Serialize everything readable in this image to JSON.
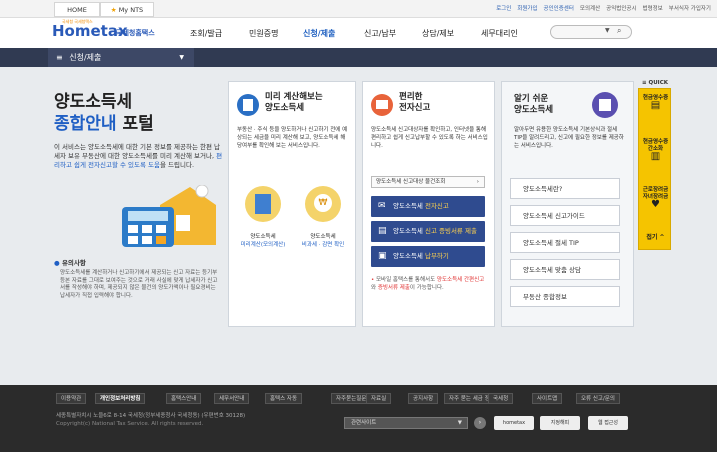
{
  "topbar": {
    "home": "HOME",
    "my_nts": "My NTS",
    "links": [
      "로그인",
      "회원가입",
      "공인인증센터",
      "모의계산",
      "공익법인공시",
      "법령정보",
      "부서식자 가입자기"
    ]
  },
  "header": {
    "logo": "Hometax",
    "logo_sub": "국세청홈택스",
    "logo_tag": "국세청 국세청택스",
    "nav": [
      "조회/발급",
      "민원증명",
      "신청/제출",
      "신고/납부",
      "상담/제보",
      "세무대리인"
    ],
    "active_nav": "신청/제출"
  },
  "subnav": {
    "label": "신청/제출"
  },
  "intro": {
    "title_line1": "양도소득세",
    "title_line2a": "종합안내",
    "title_line2b": " 포털",
    "desc_a": "이 서비스는 양도소득세에 대한 기본 정보를 제공하는 한편 납세자 보유 부동산에 대한 양도소득세를 미리 계산해 보거나, ",
    "desc_b": "편리하고 쉽게 전자신고할 수 있도록 도움",
    "desc_c": "을 드립니다.",
    "notice_title": "유의사항",
    "notice_text": "양도소득세를 계산하거나 신고하기에서 제공되는 신고 자료는 등기부등본 자료를 그대로 보여주는 것으로 거래 사실에 맞게 납세자가 신고서를 작성해야 하며, 제공되지 않은 물건의 양도가액이나 필요경비는 납세자가 직접 입력해야 합니다."
  },
  "calc": {
    "title1": "미리 계산해보는",
    "title2": "양도소득세",
    "desc": "부동산 · 주식 등을 양도하거나 신고하기 전에 예상되는 세금을 미리 계산해 보고, 양도소득세 해당여부를 확인해 보는 서비스입니다.",
    "btn1_title": "양도소득세",
    "btn1_sub": "미리계산(모의계산)",
    "btn2_title": "양도소득세",
    "btn2_sub": "비과세 · 감면 확인"
  },
  "efile": {
    "title1": "편리한",
    "title2": "전자신고",
    "desc": "양도소득세 신고대상자를 확인하고, 인터넷을 통해 편리하고 쉽게 신고납부할 수 있도록 하는 서비스입니다.",
    "lookup": "양도소득세 신고대상 물건조회",
    "b1a": "양도소득세 ",
    "b1b": "전자신고",
    "b2a": "양도소득세 ",
    "b2b": "신고 증빙서류 제출",
    "b3a": "양도소득세 ",
    "b3b": "납부하기",
    "note_a": "모바일 홈택스를 통해서도 ",
    "note_b": "양도소득세 간편신고",
    "note_c": "와 ",
    "note_d": "증빙서류 제출",
    "note_e": "이 가능합니다."
  },
  "guide": {
    "title1": "알기 쉬운",
    "title2": "양도소득세",
    "desc": "알아두면 유용한 양도소득세 기본상식과 절세 TIP을 알려드리고, 신고에 필요한 정보를 제공하는 서비스입니다.",
    "items": [
      "양도소득세란?",
      "양도소득세 신고가이드",
      "양도소득세 절세 TIP",
      "양도소득세 맞춤 상담",
      "부동산 종합정보"
    ]
  },
  "quick": {
    "label": "QUICK",
    "items": [
      "현금영수증",
      "현금영수증간소화",
      "근로장려금자녀장려금"
    ],
    "close": "접기"
  },
  "footer": {
    "links": [
      "이용약관",
      "개인정보처리방침",
      "홈택스안내",
      "세무서안내",
      "홈텍스 자동",
      "자주묻는질문",
      "자료실",
      "공지사항",
      "자주 묻는 세금 정보",
      "국세청",
      "사이트맵",
      "오류 신고/문의"
    ],
    "address": "세종특별자치시 노을6로 8-14 국세청(정부세종청사 국세청동) (우편번호 30128)",
    "copyright": "Copyright(c) National Tax Service. All rights reserved.",
    "related_select": "관련사이트",
    "badges": [
      "hometax",
      "지정해피",
      "웹 접근성"
    ]
  }
}
